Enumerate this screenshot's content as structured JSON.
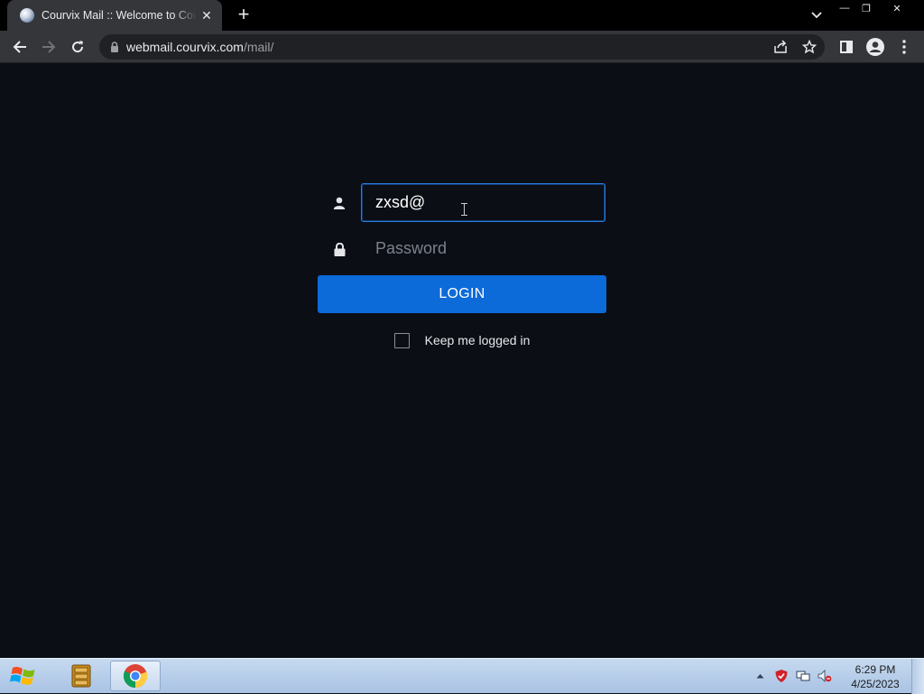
{
  "browser": {
    "tab_title": "Courvix Mail :: Welcome to Courvix Mail",
    "tab_close": "✕",
    "new_tab": "+",
    "url_host": "webmail.courvix.com",
    "url_path": "/mail/"
  },
  "window_controls": {
    "minimize": "—",
    "restore": "❐",
    "close": "✕"
  },
  "login": {
    "username_value": "zxsd@",
    "password_placeholder": "Password",
    "login_button": "LOGIN",
    "keep_logged_in": "Keep me logged in"
  },
  "taskbar": {
    "time": "6:29 PM",
    "date": "4/25/2023"
  },
  "colors": {
    "page_background": "#0b0e15",
    "login_button": "#0d6ad9",
    "focus_border": "#2b7de1"
  },
  "icons": {
    "username": "user-icon",
    "password": "lock-icon",
    "start": "windows-logo-icon",
    "task_1": "file-cabinet-icon",
    "task_2": "chrome-icon"
  }
}
